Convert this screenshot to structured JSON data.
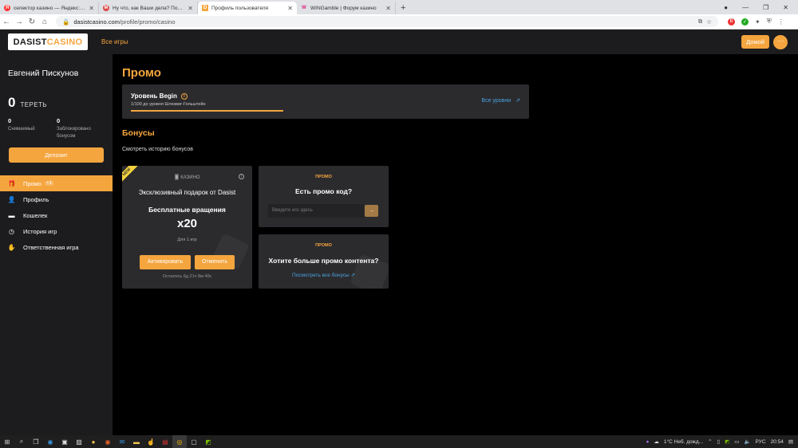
{
  "browser": {
    "tabs": [
      {
        "title": "селектор казино — Яндекс: нашлось",
        "fav_color": "#f33",
        "fav_letter": "Я"
      },
      {
        "title": "Ну что, как Ваши дела? Подумали",
        "fav_color": "#d44",
        "fav_letter": "M"
      },
      {
        "title": "Профиль пользователя",
        "fav_color": "#f5a53e",
        "fav_letter": "D",
        "active": true
      },
      {
        "title": "WINGamble | Форум казино",
        "fav_color": "#e0267f",
        "fav_letter": "W"
      }
    ],
    "url_host": "dasistcasino.com",
    "url_path": "/profile/promo/casino"
  },
  "header": {
    "logo_part1": "DASIST",
    "logo_part2": "CASINO",
    "all_games": "Все игры",
    "home_button": "Домой",
    "more_button": "···"
  },
  "sidebar": {
    "user_name": "Евгений Пискунов",
    "balance_value": "0",
    "balance_currency": "ТЕРЕТЬ",
    "withdrawable_value": "0",
    "withdrawable_label": "Снимаемый",
    "blocked_value": "0",
    "blocked_label_1": "Заблокировано",
    "blocked_label_2": "бонусом",
    "deposit_button": "Депозит",
    "menu": [
      {
        "label": "Промо",
        "badge": "+1",
        "icon": "🎁"
      },
      {
        "label": "Профиль",
        "icon": "👤"
      },
      {
        "label": "Кошелек",
        "icon": "▬"
      },
      {
        "label": "История игр",
        "icon": "◷"
      },
      {
        "label": "Ответственная игра",
        "icon": "✋"
      }
    ]
  },
  "main": {
    "page_title": "Промо",
    "level": {
      "title": "Уровень Begin",
      "subtitle": "1/100 до уровня Шлезвиг-Гольштейн",
      "all_levels_link": "Все уровни"
    },
    "bonuses_title": "Бонусы",
    "history_link": "Смотреть историю бонусов",
    "bonus_card": {
      "new_tag": "NEW",
      "category": "КАЗИНО",
      "title": "Эксклюзивный подарок от Dasist",
      "type": "Бесплатные вращения",
      "amount": "x20",
      "for_games": "Для 1 игр",
      "activate_button": "Активировать",
      "cancel_button": "Отменить",
      "time_left": "Осталось 6д 21ч 8м 40с"
    },
    "promo_code_card": {
      "label": "ПРОМО",
      "question": "Есть промо код?",
      "input_placeholder": "Введите его здесь",
      "submit_icon": "→"
    },
    "promo_content_card": {
      "label": "ПРОМО",
      "question": "Хотите больше промо контента?",
      "link": "Посмотреть все бонусы"
    }
  },
  "taskbar": {
    "weather": "1°C  Неб. дожд...",
    "lang": "РУС",
    "time": "20:54"
  }
}
